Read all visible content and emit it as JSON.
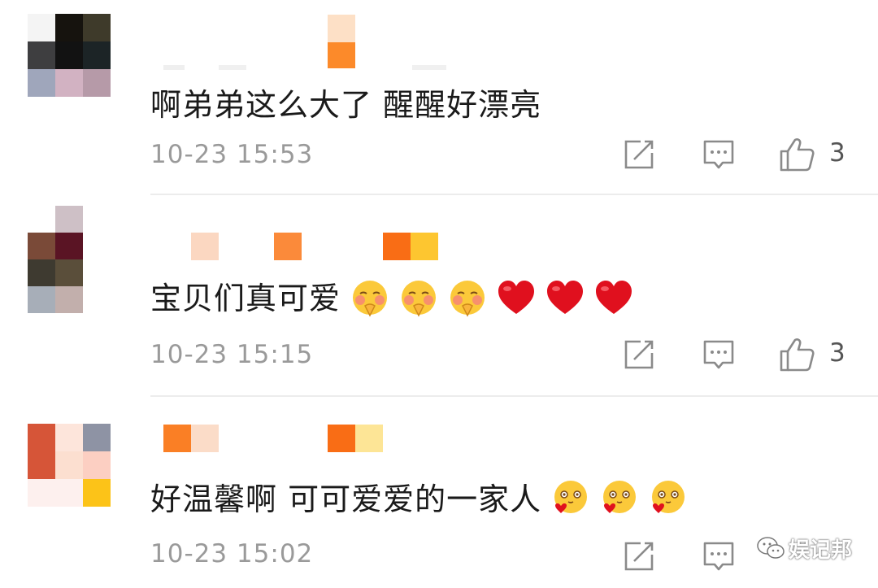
{
  "comments": [
    {
      "text": "啊弟弟这么大了 醒醒好漂亮",
      "emojis": [],
      "time": "10-23 15:53",
      "likes": "3",
      "avatar_colors": [
        "#f4f4f4",
        "#16130e",
        "#3e3a2a",
        "#3e3e40",
        "#121212",
        "#1c2426",
        "#9fa6bb",
        "#d2b2c2",
        "#b69aa8"
      ],
      "name_block_colors": [
        "#fde0c6",
        "#fc8a2a"
      ]
    },
    {
      "text": "宝贝们真可爱",
      "emojis": [
        "blush-hands-emoji",
        "blush-hands-emoji",
        "blush-hands-emoji",
        "heart-emoji",
        "heart-emoji",
        "heart-emoji"
      ],
      "time": "10-23 15:15",
      "likes": "3",
      "avatar_colors": [
        "#ffffff",
        "#cec0c6",
        "#ffffff",
        "#7a4a38",
        "#5a1424",
        "#ffffff",
        "#3e3a30",
        "#5a4e3a",
        "#ffffff",
        "#a7aeb8",
        "#c2afac",
        "#ffffff"
      ],
      "name_block_colors": [
        "#fbd7c1",
        "#fb8a3a",
        "#f96d15",
        "#fdc630"
      ]
    },
    {
      "text": "好温馨啊 可可爱爱的一家人",
      "emojis": [
        "love-face-emoji",
        "love-face-emoji",
        "love-face-emoji"
      ],
      "time": "10-23 15:02",
      "likes": "",
      "avatar_colors": [
        "#d65538",
        "#fde5db",
        "#8e93a4",
        "#d65538",
        "#fcdfd0",
        "#fccfc2",
        "#fdf0ee",
        "#fdf0ee",
        "#fcc318"
      ],
      "name_block_colors": [
        "#fa7f25",
        "#fbdcc8",
        "#f96d15",
        "#fde596"
      ]
    }
  ],
  "watermark": {
    "text": "娱记邦",
    "icon": "wechat-icon"
  }
}
